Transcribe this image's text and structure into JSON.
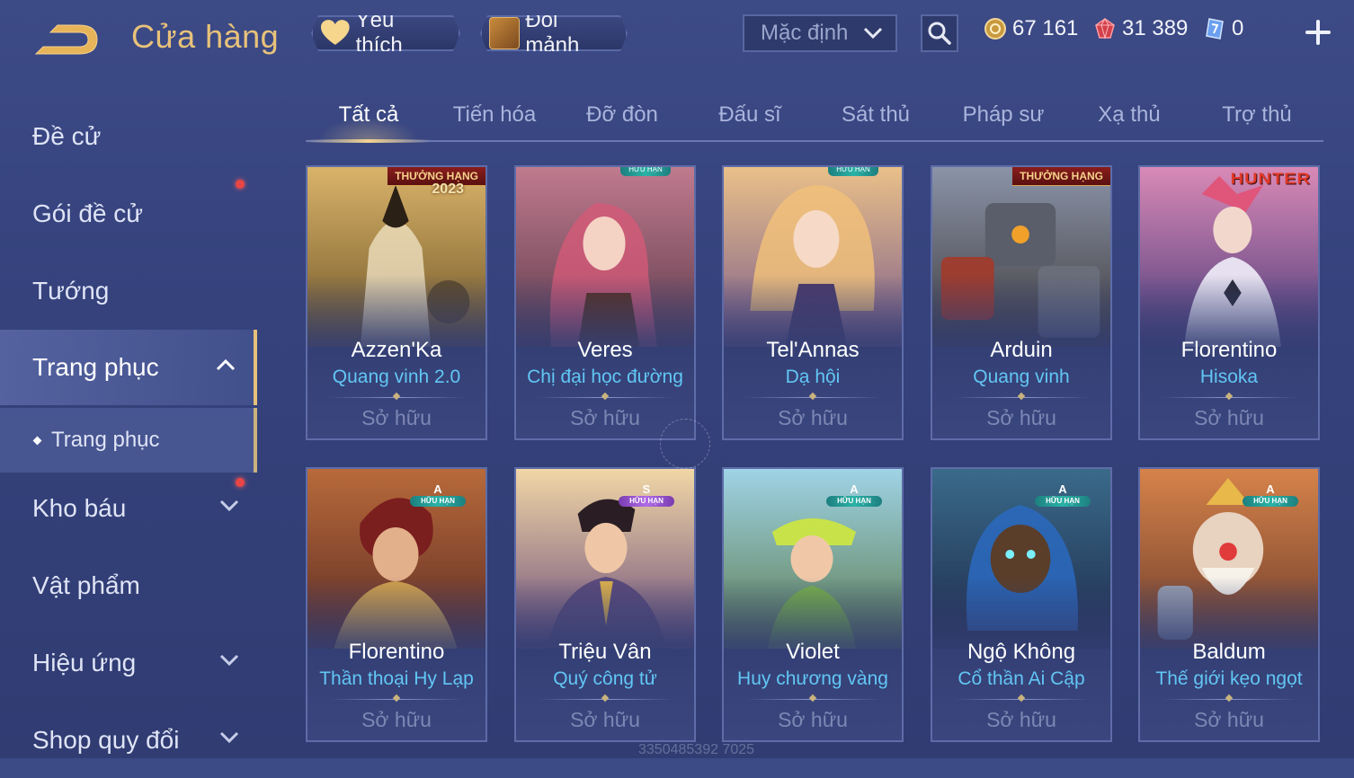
{
  "header": {
    "title": "Cửa hàng",
    "favorites_label": "Yêu thích",
    "exchange_label": "Đổi mảnh",
    "sort_value": "Mặc định",
    "currencies": [
      {
        "icon": "gold-coin-icon",
        "value": "67 161"
      },
      {
        "icon": "ruby-gem-icon",
        "value": "31 389"
      },
      {
        "icon": "blue-ticket-icon",
        "value": "0"
      }
    ]
  },
  "sidebar": {
    "items": [
      {
        "label": "Đề cử"
      },
      {
        "label": "Gói đề cử",
        "notification": true
      },
      {
        "label": "Tướng"
      },
      {
        "label": "Trang phục",
        "expanded": true,
        "active": true
      },
      {
        "label": "Trang phục",
        "sub": true
      },
      {
        "label": "Kho báu",
        "notification": true
      },
      {
        "label": "Vật phẩm"
      },
      {
        "label": "Hiệu ứng"
      },
      {
        "label": "Shop quy đổi"
      }
    ]
  },
  "tabs": [
    "Tất cả",
    "Tiến hóa",
    "Đỡ đòn",
    "Đấu sĩ",
    "Sát thủ",
    "Pháp sư",
    "Xạ thủ",
    "Trợ thủ"
  ],
  "active_tab": "Tất cả",
  "cards": [
    {
      "hero": "Azzen'Ka",
      "skin": "Quang vinh 2.0",
      "status": "Sở hữu",
      "ribbon": "THƯỞNG HẠNG",
      "ribbon_year": "2023",
      "art_color_top": "#d9b36a",
      "art_color_bottom": "#6e5426"
    },
    {
      "hero": "Veres",
      "skin": "Chị đại học đường",
      "status": "Sở hữu",
      "top_badge": "HỮU HẠN",
      "art_color_top": "#c07a8e",
      "art_color_bottom": "#5b3a4a"
    },
    {
      "hero": "Tel'Annas",
      "skin": "Dạ hội",
      "status": "Sở hữu",
      "top_badge": "HỮU HẠN",
      "art_color_top": "#e9c089",
      "art_color_bottom": "#7a5a8a"
    },
    {
      "hero": "Arduin",
      "skin": "Quang vinh",
      "status": "Sở hữu",
      "ribbon": "THƯỞNG HẠNG",
      "art_color_top": "#8a93a8",
      "art_color_bottom": "#3e3a3a"
    },
    {
      "hero": "Florentino",
      "skin": "Hisoka",
      "status": "Sở hữu",
      "logo": "HUNTER",
      "art_color_top": "#d98ab6",
      "art_color_bottom": "#4a3a7a"
    },
    {
      "hero": "Florentino",
      "skin": "Thần thoại Hy Lạp",
      "status": "Sở hữu",
      "tier": "A",
      "tier_sub": "HỮU HẠN",
      "art_color_top": "#b86a3a",
      "art_color_bottom": "#5b2a24"
    },
    {
      "hero": "Triệu Vân",
      "skin": "Quý công tử",
      "status": "Sở hữu",
      "tier": "S",
      "tier_sub": "HỮU HẠN",
      "art_color_top": "#f1d7a6",
      "art_color_bottom": "#6a4a7a"
    },
    {
      "hero": "Violet",
      "skin": "Huy chương vàng",
      "status": "Sở hữu",
      "tier": "A",
      "tier_sub": "HỮU HẠN",
      "art_color_top": "#9fd3e6",
      "art_color_bottom": "#5a7a4a"
    },
    {
      "hero": "Ngộ Không",
      "skin": "Cổ thần Ai Cập",
      "status": "Sở hữu",
      "tier": "A",
      "tier_sub": "HỮU HẠN",
      "art_color_top": "#3a6a8a",
      "art_color_bottom": "#1e2a4a"
    },
    {
      "hero": "Baldum",
      "skin": "Thế giới kẹo ngọt",
      "status": "Sở hữu",
      "tier": "A",
      "tier_sub": "HỮU HẠN",
      "art_color_top": "#d6834a",
      "art_color_bottom": "#6a3a2a"
    }
  ],
  "watermark": "3350485392 7025",
  "colors": {
    "accent_gold": "#e8c27a",
    "skin_name_blue": "#62c6f4",
    "notification_red": "#e84545"
  }
}
